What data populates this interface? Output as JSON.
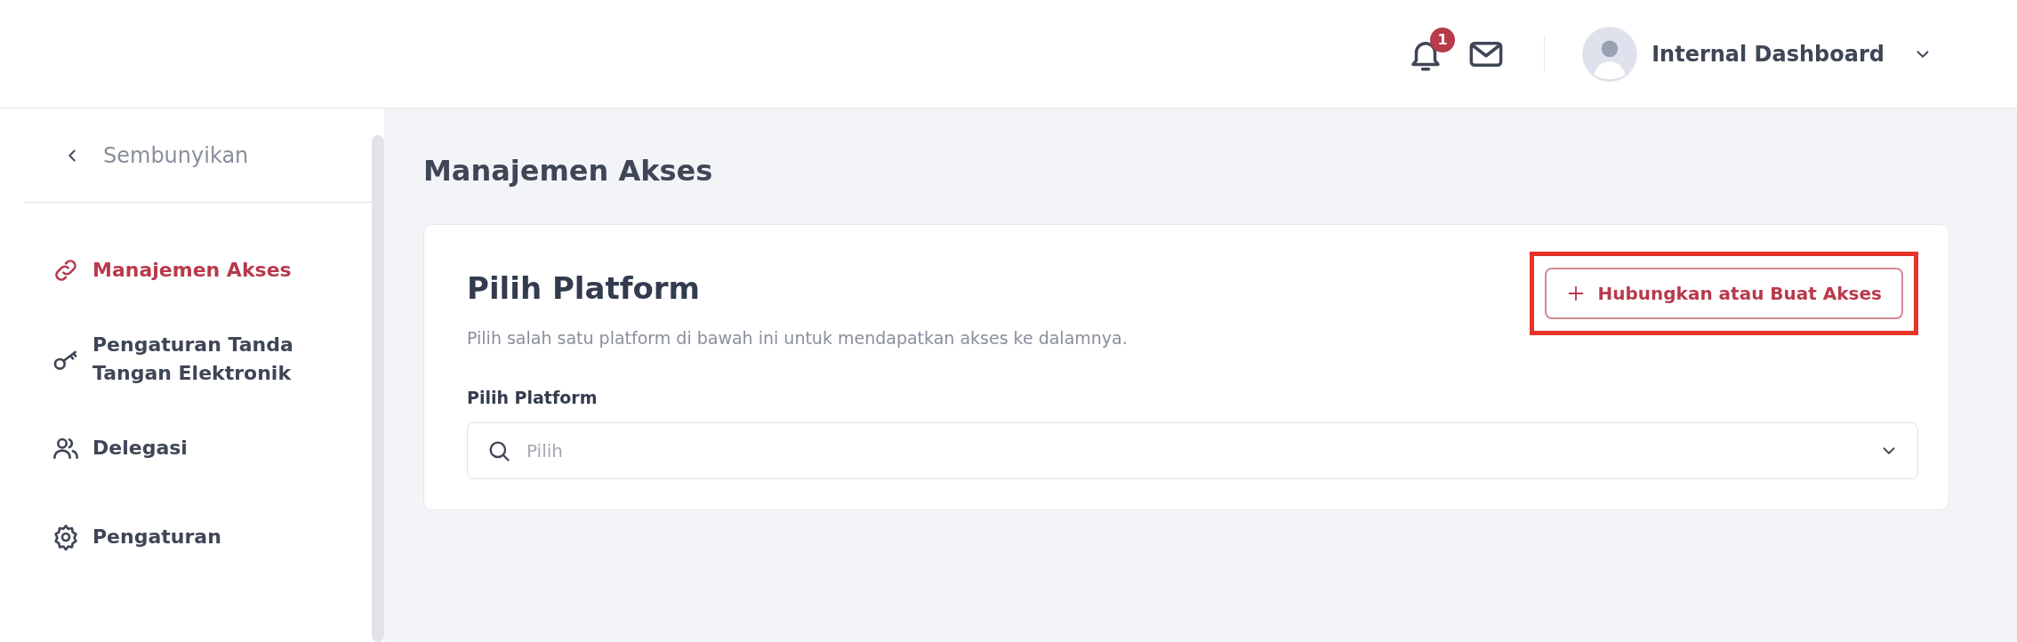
{
  "header": {
    "notifications": {
      "count": "1"
    },
    "user": {
      "name": "Internal Dashboard"
    }
  },
  "sidebar": {
    "collapse_label": "Sembunyikan",
    "items": [
      {
        "label": "Manajemen Akses",
        "kind": "link",
        "selected": true
      },
      {
        "label": "Pengaturan Tanda Tangan Elektronik",
        "kind": "key",
        "selected": false
      },
      {
        "label": "Delegasi",
        "kind": "users",
        "selected": false
      },
      {
        "label": "Pengaturan",
        "kind": "gear",
        "selected": false
      }
    ]
  },
  "page_title": "Manajemen Akses",
  "card": {
    "title": "Pilih Platform",
    "description": "Pilih salah satu platform di bawah ini untuk mendapatkan akses ke dalamnya.",
    "button": {
      "label": "Hubungkan atau Buat Akses",
      "highlighted": true
    },
    "field": {
      "label": "Pilih Platform",
      "placeholder": "Pilih"
    }
  }
}
